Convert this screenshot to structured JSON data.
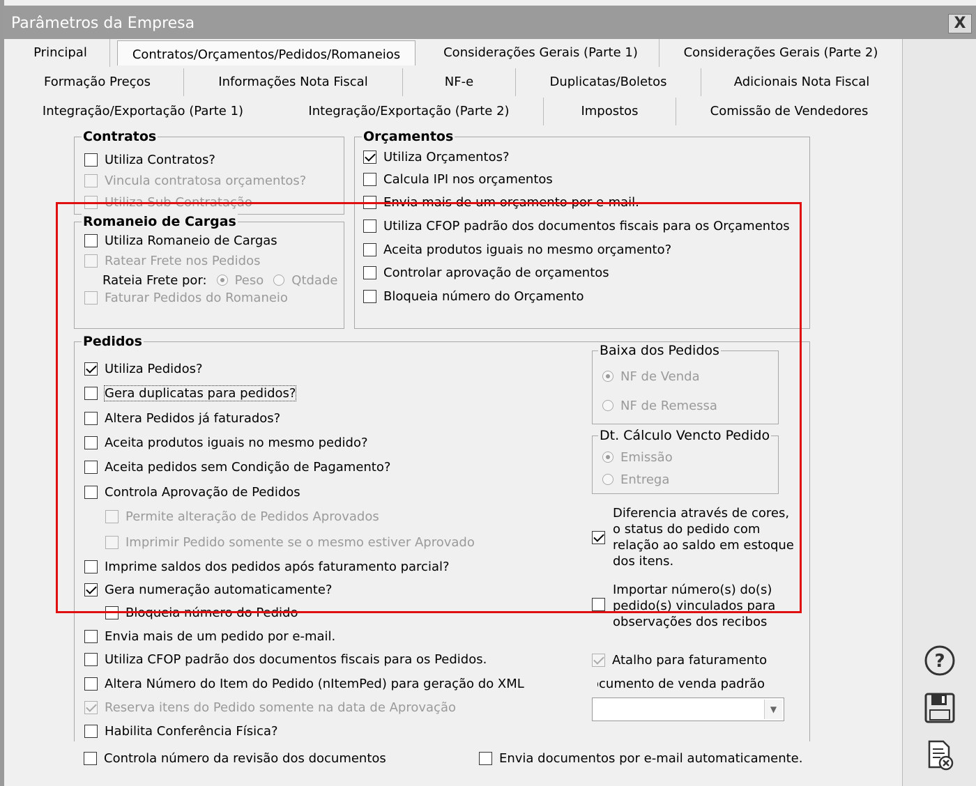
{
  "window": {
    "title": "Parâmetros da Empresa",
    "close_label": "X"
  },
  "tabs": {
    "row1": [
      "Principal",
      "Contratos/Orçamentos/Pedidos/Romaneios",
      "Considerações Gerais (Parte 1)",
      "Considerações Gerais (Parte 2)"
    ],
    "row2": [
      "Formação Preços",
      "Informações Nota Fiscal",
      "NF-e",
      "Duplicatas/Boletos",
      "Adicionais Nota Fiscal"
    ],
    "row3": [
      "Integração/Exportação (Parte 1)",
      "Integração/Exportação (Parte 2)",
      "Impostos",
      "Comissão de Vendedores"
    ],
    "active": "Contratos/Orçamentos/Pedidos/Romaneios"
  },
  "contratos": {
    "title": "Contratos",
    "items": [
      {
        "label": "Utiliza Contratos?",
        "checked": false,
        "enabled": true
      },
      {
        "label": "Vincula contratosa orçamentos?",
        "checked": false,
        "enabled": false
      },
      {
        "label": "Utiliza Sub Contratação",
        "checked": false,
        "enabled": false
      }
    ]
  },
  "romaneio": {
    "title": "Romaneio de Cargas",
    "utiliza": "Utiliza Romaneio de Cargas",
    "ratear": "Ratear Frete nos Pedidos",
    "rateia_label": "Rateia Frete por:",
    "radio_peso": "Peso",
    "radio_qtdade": "Qtdade",
    "faturar": "Faturar Pedidos do Romaneio"
  },
  "orcamentos": {
    "title": "Orçamentos",
    "items": [
      {
        "label": "Utiliza Orçamentos?",
        "checked": true
      },
      {
        "label": "Calcula IPI nos orçamentos",
        "checked": false
      },
      {
        "label": "Envia mais de um orçamento por e-mail.",
        "checked": false
      },
      {
        "label": "Utiliza CFOP padrão dos documentos fiscais para os Orçamentos",
        "checked": false
      },
      {
        "label": "Aceita produtos iguais no mesmo orçamento?",
        "checked": false
      },
      {
        "label": "Controlar aprovação de orçamentos",
        "checked": false
      },
      {
        "label": "Bloqueia número do Orçamento",
        "checked": false
      }
    ]
  },
  "pedidos": {
    "title": "Pedidos",
    "items": [
      {
        "label": "Utiliza Pedidos?",
        "checked": true
      },
      {
        "label": "Gera duplicatas para pedidos?",
        "checked": false
      },
      {
        "label": "Altera Pedidos já faturados?",
        "checked": false
      },
      {
        "label": "Aceita produtos iguais no mesmo pedido?",
        "checked": false
      },
      {
        "label": "Aceita pedidos sem Condição de Pagamento?",
        "checked": false
      },
      {
        "label": "Controla Aprovação de Pedidos",
        "checked": false
      },
      {
        "label": "Permite alteração de Pedidos Aprovados",
        "checked": false
      },
      {
        "label": "Imprimir Pedido somente se o mesmo estiver Aprovado",
        "checked": false
      },
      {
        "label": "Imprime saldos dos pedidos após faturamento parcial?",
        "checked": false
      },
      {
        "label": "Gera  numeração automaticamente?",
        "checked": true
      },
      {
        "label": "Bloqueia número do Pedido",
        "checked": false
      },
      {
        "label": "Envia mais de um pedido por e-mail.",
        "checked": false
      },
      {
        "label": "Utiliza CFOP padrão dos documentos fiscais para os Pedidos.",
        "checked": false
      },
      {
        "label": "Altera Número do Item do Pedido (nItemPed) para geração do XML",
        "checked": false
      },
      {
        "label": "Reserva itens do Pedido somente na data de Aprovação",
        "checked": true
      },
      {
        "label": "Habilita Conferência Física?",
        "checked": false
      }
    ],
    "baixa": {
      "title": "Baixa dos Pedidos",
      "opt1": "NF de Venda",
      "opt2": "NF de Remessa"
    },
    "dtcalc": {
      "title": "Dt. Cálculo Vencto Pedido",
      "opt1": "Emissão",
      "opt2": "Entrega"
    },
    "diferencia": "Diferencia através de cores, o status do pedido com relação ao saldo em estoque dos itens.",
    "importar": "Importar número(s) do(s) pedido(s) vinculados para observações dos recibos",
    "atalho": "Atalho para faturamento",
    "doc_label": "Documento de venda padrão",
    "doc_value": ""
  },
  "footer": {
    "revisao": "Controla número da revisão dos documentos",
    "envia_docs": "Envia documentos por e-mail automaticamente."
  },
  "side_buttons": {
    "help": "help-icon",
    "save": "save-icon",
    "cancel": "cancel-document-icon"
  }
}
